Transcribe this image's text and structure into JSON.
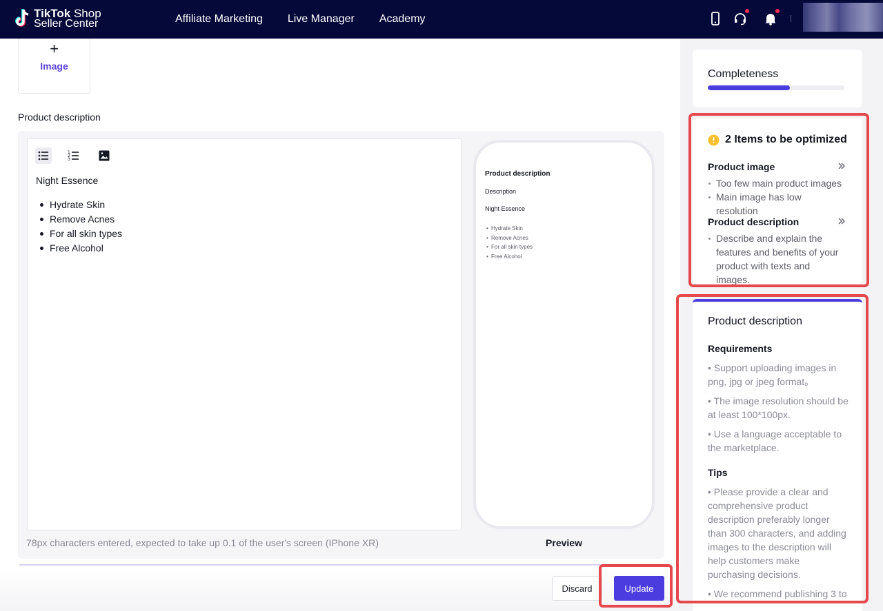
{
  "header": {
    "logo_line1_bold": "TikTok",
    "logo_line1_rest": " Shop",
    "logo_line2": "Seller Center",
    "nav": [
      "Affiliate Marketing",
      "Live Manager",
      "Academy"
    ]
  },
  "colors": {
    "header_bg": "#05093a",
    "accent": "#4b3ce0",
    "highlight": "#e5484d"
  },
  "upload": {
    "label": "Image"
  },
  "description": {
    "section_label": "Product description",
    "editor_title": "Night Essence",
    "bullets": [
      "Hydrate Skin",
      "Remove Acnes",
      "For all skin types",
      "Free Alcohol"
    ],
    "hint": "78px characters entered, expected to take up 0.1 of the user's screen (IPhone XR)",
    "preview": {
      "title": "Product description",
      "subtitle": "Description",
      "name": "Night Essence",
      "bullets": [
        "Hydrate Skin",
        "Remove Acnes",
        "For all skin types",
        "Free Alcohol"
      ],
      "label": "Preview"
    }
  },
  "actions": {
    "discard": "Discard",
    "update": "Update"
  },
  "completeness": {
    "title": "Completeness",
    "progress": 0.6
  },
  "optimize": {
    "title": "2 Items to be optimized",
    "sections": [
      {
        "title": "Product image",
        "items": [
          "Too few main product images",
          "Main image has low resolution"
        ]
      },
      {
        "title": "Product description",
        "items": [
          "Describe and explain the features and benefits of your product with texts and images."
        ]
      }
    ]
  },
  "guide": {
    "title": "Product description",
    "requirements_title": "Requirements",
    "requirements": [
      "• Support uploading images in png, jpg or jpeg format。",
      "• The image resolution should be at least 100*100px.",
      "• Use a language acceptable to the marketplace."
    ],
    "tips_title": "Tips",
    "tips": [
      "• Please provide a clear and comprehensive product description preferably longer than 300 characters, and adding images to the description will help customers make purchasing decisions.",
      "• We recommend publishing 3 to"
    ]
  }
}
